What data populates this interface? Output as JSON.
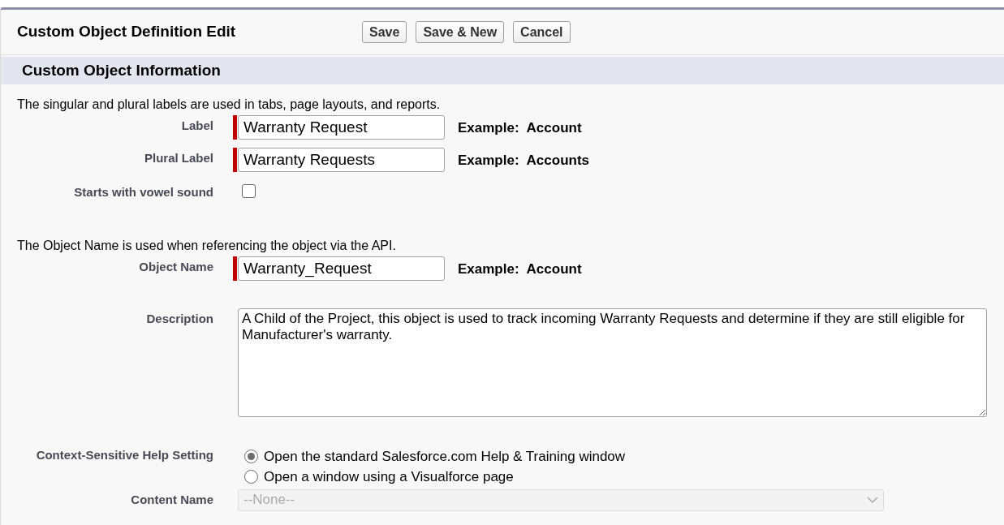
{
  "header": {
    "title": "Custom Object Definition Edit",
    "buttons": [
      "Save",
      "Save & New",
      "Cancel"
    ]
  },
  "section": {
    "title": "Custom Object Information"
  },
  "rows": [
    {
      "kind": "note",
      "text": "The singular and plural labels are used in tabs, page layouts, and reports."
    },
    {
      "kind": "text",
      "label": "Label",
      "value": "Warranty Request",
      "required": true,
      "example_label": "Example:",
      "example": "Account"
    },
    {
      "kind": "text",
      "label": "Plural Label",
      "value": "Warranty Requests",
      "required": true,
      "example_label": "Example:",
      "example": "Accounts"
    },
    {
      "kind": "checkbox",
      "label": "Starts with vowel sound",
      "checked": false
    },
    {
      "kind": "note",
      "text": "The Object Name is used when referencing the object via the API."
    },
    {
      "kind": "text",
      "label": "Object Name",
      "value": "Warranty_Request",
      "required": true,
      "example_label": "Example:",
      "example": "Account"
    },
    {
      "kind": "textarea",
      "label": "Description",
      "value": "A Child of the Project, this object is used to track incoming Warranty Requests and determine if they are still eligible for Manufacturer's warranty."
    },
    {
      "kind": "radio",
      "label": "Context-Sensitive Help Setting",
      "options": [
        {
          "label": "Open the standard Salesforce.com Help & Training window",
          "selected": true
        },
        {
          "label": "Open a window using a Visualforce page",
          "selected": false
        }
      ]
    },
    {
      "kind": "select",
      "label": "Content Name",
      "value": "--None--",
      "disabled": true
    }
  ]
}
